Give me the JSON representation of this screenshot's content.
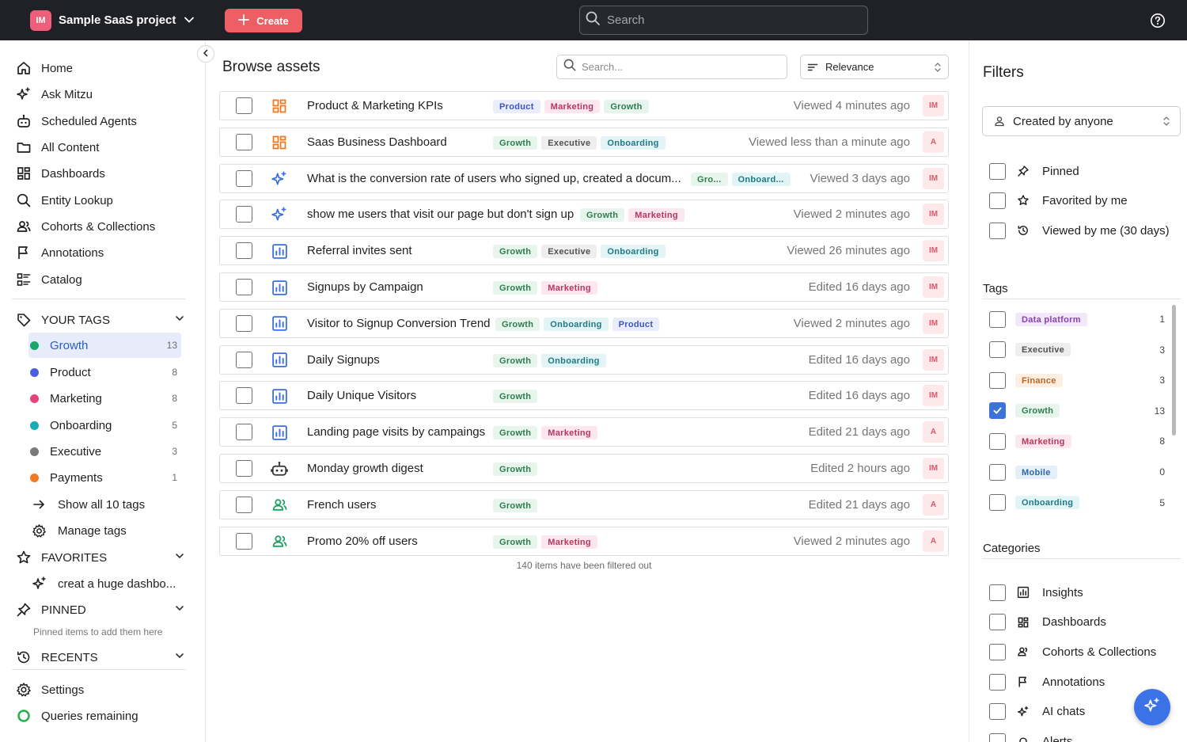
{
  "topbar": {
    "project_initials": "IM",
    "project_name": "Sample SaaS project",
    "create_label": "Create",
    "search_placeholder": "Search"
  },
  "sidebar": {
    "nav": [
      {
        "label": "Home",
        "icon": "home-icon"
      },
      {
        "label": "Ask Mitzu",
        "icon": "sparkle-icon"
      },
      {
        "label": "Scheduled Agents",
        "icon": "robot-icon"
      },
      {
        "label": "All Content",
        "icon": "folder-icon"
      },
      {
        "label": "Dashboards",
        "icon": "dashboard-icon"
      },
      {
        "label": "Entity Lookup",
        "icon": "search-icon"
      },
      {
        "label": "Cohorts & Collections",
        "icon": "users-icon"
      },
      {
        "label": "Annotations",
        "icon": "flag-icon"
      },
      {
        "label": "Catalog",
        "icon": "catalog-icon"
      }
    ],
    "your_tags_label": "YOUR TAGS",
    "tags": [
      {
        "label": "Growth",
        "count": "13",
        "color": "#1aa66a"
      },
      {
        "label": "Product",
        "count": "8",
        "color": "#4a5fe0"
      },
      {
        "label": "Marketing",
        "count": "8",
        "color": "#e5437a"
      },
      {
        "label": "Onboarding",
        "count": "5",
        "color": "#1aaab5"
      },
      {
        "label": "Executive",
        "count": "3",
        "color": "#7a7a7a"
      },
      {
        "label": "Payments",
        "count": "1",
        "color": "#f07a22"
      }
    ],
    "show_all_tags": "Show all 10 tags",
    "manage_tags": "Manage tags",
    "favorites_label": "FAVORITES",
    "favorite_item": "creat a huge dashbo...",
    "pinned_label": "PINNED",
    "pinned_hint": "Pinned items to add them here",
    "recents_label": "RECENTS",
    "settings_label": "Settings",
    "queries_label": "Queries remaining"
  },
  "main": {
    "title": "Browse assets",
    "search_placeholder": "Search...",
    "sort_label": "Relevance",
    "rows": [
      {
        "name": "Product & Marketing KPIs",
        "type": "dashboard",
        "tags": [
          "Product",
          "Marketing",
          "Growth"
        ],
        "time": "Viewed 4 minutes ago",
        "owner": "IM"
      },
      {
        "name": "Saas Business Dashboard",
        "type": "dashboard",
        "tags": [
          "Growth",
          "Executive",
          "Onboarding"
        ],
        "time": "Viewed less than a minute ago",
        "owner": "A"
      },
      {
        "name": "What is the conversion rate of users who signed up, created a docum...",
        "type": "ai",
        "tags": [
          "Gro...",
          "Onboard..."
        ],
        "time": "Viewed 3 days ago",
        "owner": "IM"
      },
      {
        "name": "show me users that visit our page but don't sign up",
        "type": "ai",
        "tags": [
          "Growth",
          "Marketing"
        ],
        "time": "Viewed 2 minutes ago",
        "owner": "IM"
      },
      {
        "name": "Referral invites sent",
        "type": "insight",
        "tags": [
          "Growth",
          "Executive",
          "Onboarding"
        ],
        "time": "Viewed 26 minutes ago",
        "owner": "IM"
      },
      {
        "name": "Signups by Campaign",
        "type": "insight",
        "tags": [
          "Growth",
          "Marketing"
        ],
        "time": "Edited 16 days ago",
        "owner": "IM"
      },
      {
        "name": "Visitor to Signup Conversion Trend",
        "type": "insight",
        "tags": [
          "Growth",
          "Onboarding",
          "Product"
        ],
        "time": "Viewed 2 minutes ago",
        "owner": "IM"
      },
      {
        "name": "Daily Signups",
        "type": "insight",
        "tags": [
          "Growth",
          "Onboarding"
        ],
        "time": "Edited 16 days ago",
        "owner": "IM"
      },
      {
        "name": "Daily Unique Visitors",
        "type": "insight",
        "tags": [
          "Growth"
        ],
        "time": "Edited 16 days ago",
        "owner": "IM"
      },
      {
        "name": "Landing page visits by campaings",
        "type": "insight",
        "tags": [
          "Growth",
          "Marketing"
        ],
        "time": "Edited 21 days ago",
        "owner": "A"
      },
      {
        "name": "Monday growth digest",
        "type": "agent",
        "tags": [
          "Growth"
        ],
        "time": "Edited 2 hours ago",
        "owner": "IM"
      },
      {
        "name": "French users",
        "type": "cohort",
        "tags": [
          "Growth"
        ],
        "time": "Edited 21 days ago",
        "owner": "A"
      },
      {
        "name": "Promo 20% off users",
        "type": "cohort",
        "tags": [
          "Growth",
          "Marketing"
        ],
        "time": "Viewed 2 minutes ago",
        "owner": "A"
      }
    ],
    "filtered_out": "140 items have been filtered out"
  },
  "filters": {
    "title": "Filters",
    "created_by": "Created by anyone",
    "quick": [
      {
        "label": "Pinned",
        "icon": "pin-icon"
      },
      {
        "label": "Favorited by me",
        "icon": "star-icon"
      },
      {
        "label": "Viewed by me (30 days)",
        "icon": "history-icon"
      }
    ],
    "tags_label": "Tags",
    "tags": [
      {
        "label": "Data platform",
        "count": "1",
        "checked": false
      },
      {
        "label": "Executive",
        "count": "3",
        "checked": false
      },
      {
        "label": "Finance",
        "count": "3",
        "checked": false
      },
      {
        "label": "Growth",
        "count": "13",
        "checked": true
      },
      {
        "label": "Marketing",
        "count": "8",
        "checked": false
      },
      {
        "label": "Mobile",
        "count": "0",
        "checked": false
      },
      {
        "label": "Onboarding",
        "count": "5",
        "checked": false
      }
    ],
    "categories_label": "Categories",
    "categories": [
      {
        "label": "Insights",
        "icon": "insight-icon"
      },
      {
        "label": "Dashboards",
        "icon": "dashboard-icon"
      },
      {
        "label": "Cohorts & Collections",
        "icon": "users-icon"
      },
      {
        "label": "Annotations",
        "icon": "flag-icon"
      },
      {
        "label": "AI chats",
        "icon": "sparkle-icon"
      },
      {
        "label": "Alerts",
        "icon": "bell-icon"
      }
    ]
  }
}
